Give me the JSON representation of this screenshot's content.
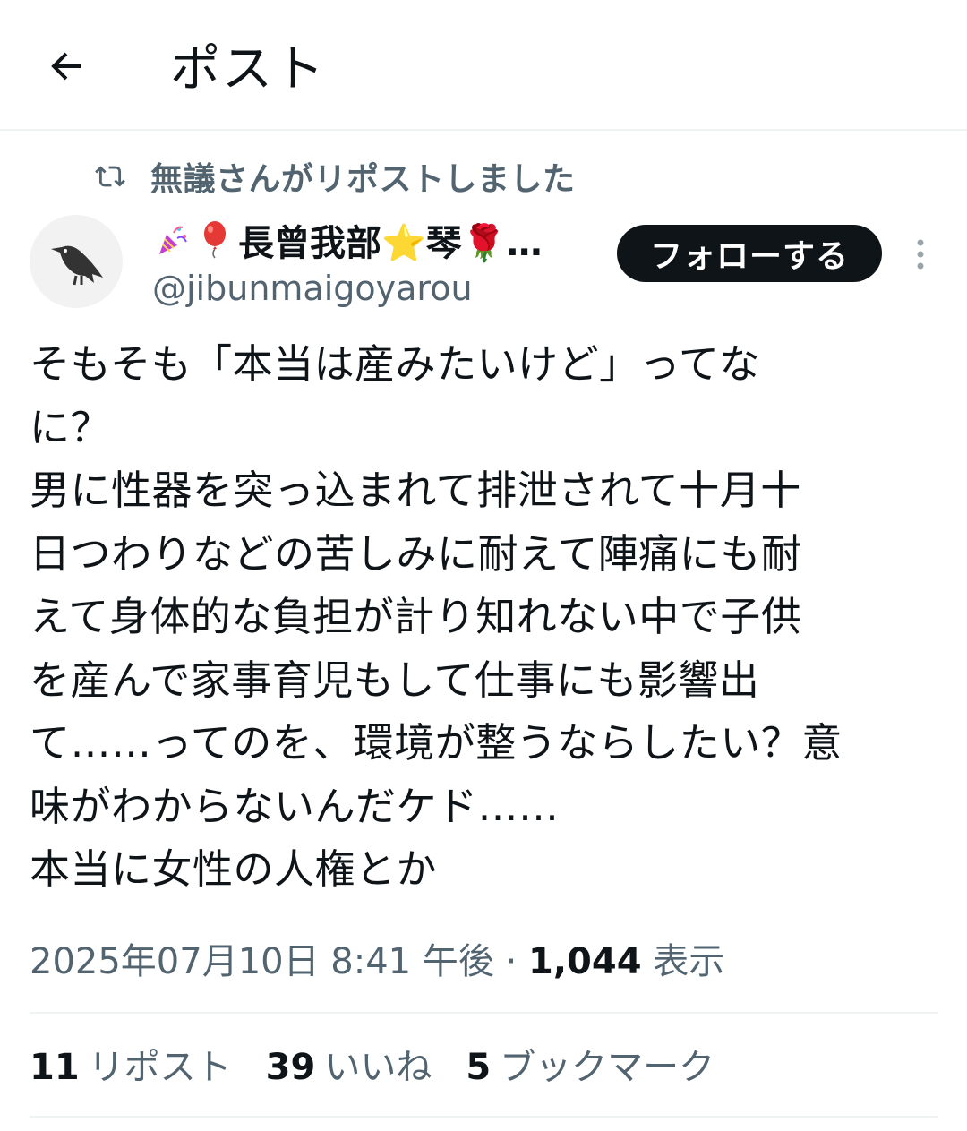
{
  "header": {
    "title": "ポスト"
  },
  "repost": {
    "text": "無議さんがリポストしました"
  },
  "author": {
    "display_name": "長曾我部⭐琴🌹…",
    "display_name_prefix_emoji": [
      "party-popper",
      "balloon"
    ],
    "handle": "@jibunmaigoyarou"
  },
  "follow_button": {
    "label": "フォローする"
  },
  "tweet": {
    "text": "そもそも「本当は産みたいけど」ってな\nに？\n男に性器を突っ込まれて排泄されて十月十\n日つわりなどの苦しみに耐えて陣痛にも耐\nえて身体的な負担が計り知れない中で子供\nを産んで家事育児もして仕事にも影響出\nて……ってのを、環境が整うならしたい？意\n味がわからないんだケド……\n本当に女性の人権とか"
  },
  "meta": {
    "datetime": "2025年07月10日 8:41 午後",
    "separator": " · ",
    "views_count": "1,044",
    "views_label": "表示"
  },
  "stats": [
    {
      "count": "11",
      "label": "リポスト"
    },
    {
      "count": "39",
      "label": "いいね"
    },
    {
      "count": "5",
      "label": "ブックマーク"
    }
  ],
  "colors": {
    "text_primary": "#0f1419",
    "text_secondary": "#536471",
    "divider": "#eff3f4",
    "follow_bg": "#0f1419"
  }
}
